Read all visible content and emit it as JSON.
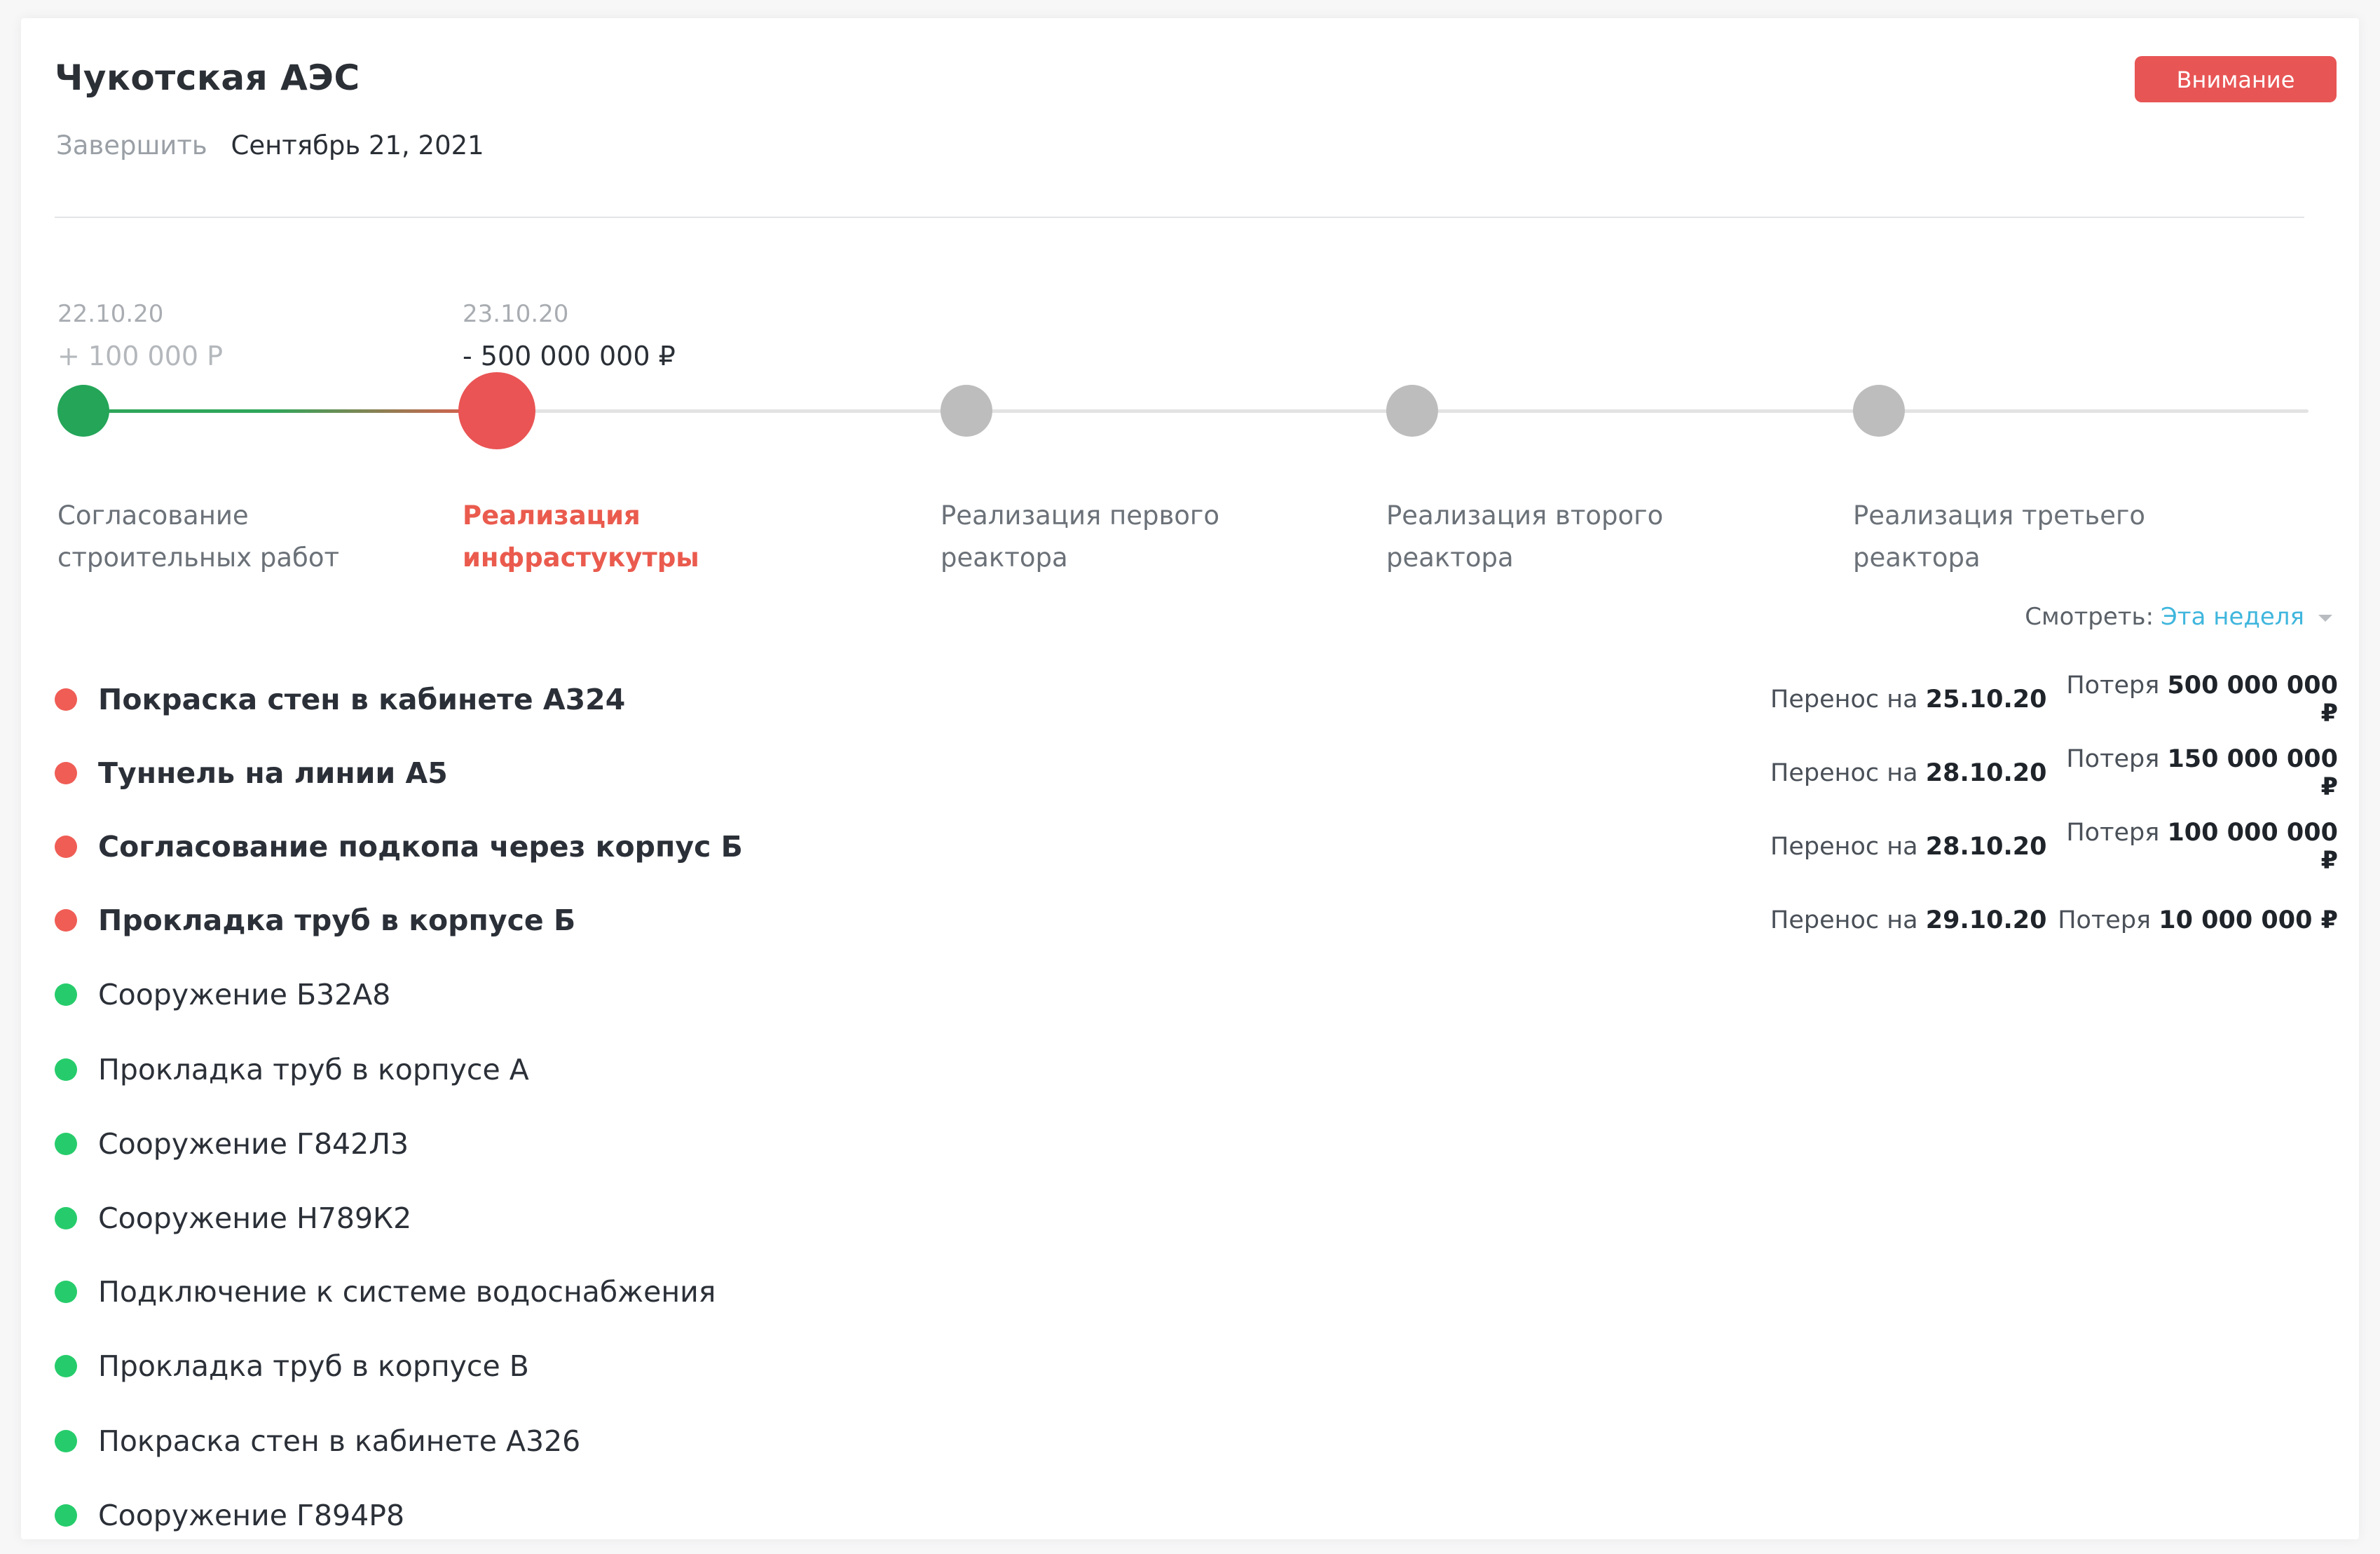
{
  "header": {
    "title": "Чукотская АЭС",
    "alert_button": "Внимание",
    "deadline_label": "Завершить",
    "deadline_value": "Сентябрь 21, 2021"
  },
  "timeline": {
    "stages": [
      {
        "date": "22.10.20",
        "money": "+ 100 000 Р",
        "label_line1": "Согласование",
        "label_line2": "строительных работ",
        "status": "done"
      },
      {
        "date": "23.10.20",
        "money": "- 500 000 000 ₽",
        "label_line1": "Реализация",
        "label_line2": "инфрастукутры",
        "status": "current"
      },
      {
        "date": "",
        "money": "",
        "label_line1": "Реализация первого",
        "label_line2": "реактора",
        "status": "pending"
      },
      {
        "date": "",
        "money": "",
        "label_line1": "Реализация второго",
        "label_line2": "реактора",
        "status": "pending"
      },
      {
        "date": "",
        "money": "",
        "label_line1": "Реализация третьего",
        "label_line2": "реактора",
        "status": "pending"
      }
    ]
  },
  "filter": {
    "label": "Смотреть:",
    "value": "Эта неделя"
  },
  "tasks": [
    {
      "name": "Покраска стен в кабинете А324",
      "status": "delayed",
      "resched_label": "Перенос на",
      "resched_date": "25.10.20",
      "loss_label": "Потеря",
      "loss_value": "500 000 000 ₽"
    },
    {
      "name": "Туннель на линии А5",
      "status": "delayed",
      "resched_label": "Перенос на",
      "resched_date": "28.10.20",
      "loss_label": "Потеря",
      "loss_value": "150 000 000 ₽"
    },
    {
      "name": "Согласование подкопа через корпус Б",
      "status": "delayed",
      "resched_label": "Перенос на",
      "resched_date": "28.10.20",
      "loss_label": "Потеря",
      "loss_value": "100 000 000 ₽"
    },
    {
      "name": "Прокладка труб в корпусе Б",
      "status": "delayed",
      "resched_label": "Перенос на",
      "resched_date": "29.10.20",
      "loss_label": "Потеря",
      "loss_value": "10 000 000 ₽"
    },
    {
      "name": "Сооружение Б32А8",
      "status": "ok"
    },
    {
      "name": "Прокладка труб в корпусе А",
      "status": "ok"
    },
    {
      "name": "Сооружение Г842Л3",
      "status": "ok"
    },
    {
      "name": "Сооружение Н789К2",
      "status": "ok"
    },
    {
      "name": "Подключение к системе водоснабжения",
      "status": "ok"
    },
    {
      "name": "Прокладка труб в корпусе В",
      "status": "ok"
    },
    {
      "name": "Покраска стен в кабинете А326",
      "status": "ok"
    },
    {
      "name": "Сооружение Г894Р8",
      "status": "ok"
    }
  ],
  "colors": {
    "alert": "#e85555",
    "done": "#24a558",
    "current": "#ea5454",
    "pending": "#bdbdbd",
    "ok_dot": "#26cc6b",
    "link": "#3fb6dd"
  },
  "icons": {
    "dropdown": "chevron-down-icon",
    "delayed_task": "status-dot-red",
    "ok_task": "status-dot-green"
  }
}
